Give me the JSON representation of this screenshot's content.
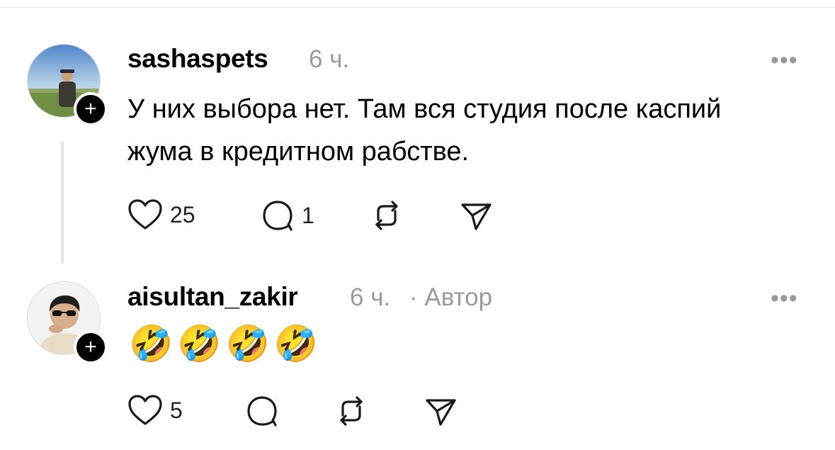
{
  "comments": [
    {
      "username": "sashaspets",
      "time": "6 ч.",
      "author_tag": "",
      "text": "У них выбора нет. Там вся студия после каспий жума в кредитном рабстве.",
      "likes": "25",
      "replies": "1",
      "follow_symbol": "+",
      "more_symbol": "•••"
    },
    {
      "username": "aisultan_zakir",
      "time": "6 ч.",
      "author_tag": "· Автор",
      "text": "🤣🤣🤣🤣",
      "likes": "5",
      "replies": "",
      "follow_symbol": "+",
      "more_symbol": "•••"
    }
  ],
  "icons": {
    "like": "heart-icon",
    "reply": "comment-icon",
    "repost": "repost-icon",
    "share": "send-icon"
  },
  "colors": {
    "secondary_text": "#9a9a9a",
    "thread_line": "#e3e3e3",
    "badge": "#000000"
  }
}
